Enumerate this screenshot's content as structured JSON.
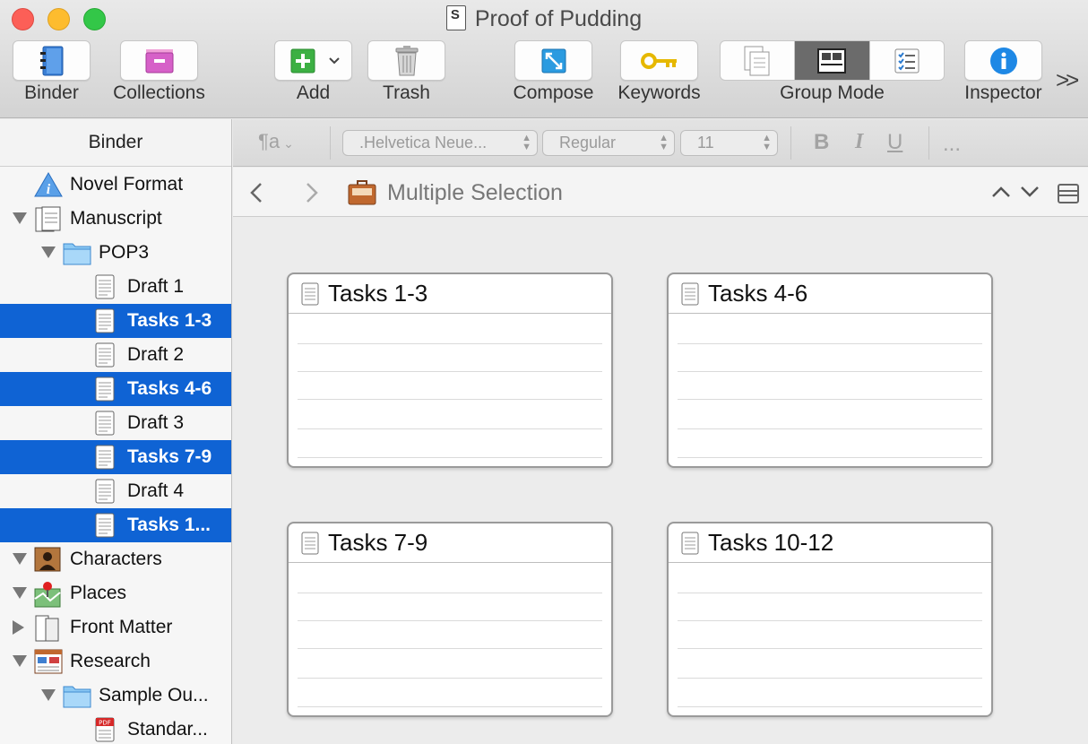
{
  "window": {
    "title": "Proof of Pudding"
  },
  "toolbar": {
    "binder": "Binder",
    "collections": "Collections",
    "add": "Add",
    "trash": "Trash",
    "compose": "Compose",
    "keywords": "Keywords",
    "group_mode": "Group Mode",
    "inspector": "Inspector",
    "overflow": ">>"
  },
  "binder": {
    "header": "Binder",
    "items": [
      {
        "label": "Novel Format",
        "icon": "info-icon",
        "indent": 0,
        "triangle": "none",
        "selected": false
      },
      {
        "label": "Manuscript",
        "icon": "manuscript-icon",
        "indent": 0,
        "triangle": "down",
        "selected": false
      },
      {
        "label": "POP3",
        "icon": "folder-icon",
        "indent": 1,
        "triangle": "down",
        "selected": false
      },
      {
        "label": "Draft 1",
        "icon": "document-icon",
        "indent": 2,
        "triangle": "none",
        "selected": false
      },
      {
        "label": "Tasks 1-3",
        "icon": "document-icon",
        "indent": 2,
        "triangle": "none",
        "selected": true
      },
      {
        "label": "Draft 2",
        "icon": "document-icon",
        "indent": 2,
        "triangle": "none",
        "selected": false
      },
      {
        "label": "Tasks 4-6",
        "icon": "document-icon",
        "indent": 2,
        "triangle": "none",
        "selected": true
      },
      {
        "label": "Draft 3",
        "icon": "document-icon",
        "indent": 2,
        "triangle": "none",
        "selected": false
      },
      {
        "label": "Tasks 7-9",
        "icon": "document-icon",
        "indent": 2,
        "triangle": "none",
        "selected": true
      },
      {
        "label": "Draft 4",
        "icon": "document-icon",
        "indent": 2,
        "triangle": "none",
        "selected": false
      },
      {
        "label": "Tasks 1...",
        "icon": "document-icon",
        "indent": 2,
        "triangle": "none",
        "selected": true
      },
      {
        "label": "Characters",
        "icon": "characters-icon",
        "indent": 0,
        "triangle": "down",
        "selected": false
      },
      {
        "label": "Places",
        "icon": "places-icon",
        "indent": 0,
        "triangle": "down",
        "selected": false
      },
      {
        "label": "Front Matter",
        "icon": "front-matter-icon",
        "indent": 0,
        "triangle": "right",
        "selected": false
      },
      {
        "label": "Research",
        "icon": "research-icon",
        "indent": 0,
        "triangle": "down",
        "selected": false
      },
      {
        "label": "Sample Ou...",
        "icon": "folder-icon",
        "indent": 1,
        "triangle": "down",
        "selected": false
      },
      {
        "label": "Standar...",
        "icon": "pdf-icon",
        "indent": 2,
        "triangle": "none",
        "selected": false
      }
    ]
  },
  "formatbar": {
    "paragraph_style": "¶a",
    "font_family": ".Helvetica Neue...",
    "font_style": "Regular",
    "font_size": "11",
    "bold": "B",
    "italic": "I",
    "underline": "U",
    "more": "..."
  },
  "navbar": {
    "title": "Multiple Selection"
  },
  "cards": [
    {
      "title": "Tasks 1-3"
    },
    {
      "title": "Tasks 4-6"
    },
    {
      "title": "Tasks 7-9"
    },
    {
      "title": "Tasks 10-12"
    }
  ],
  "colors": {
    "selection": "#0f63d4",
    "close": "#fc5f57",
    "minimize": "#fdbc2e",
    "zoom": "#33c748",
    "inspector_blue": "#1e88e5",
    "compose_blue": "#2b9be0",
    "add_green": "#3cb043",
    "keywords_gold": "#e6b800"
  }
}
